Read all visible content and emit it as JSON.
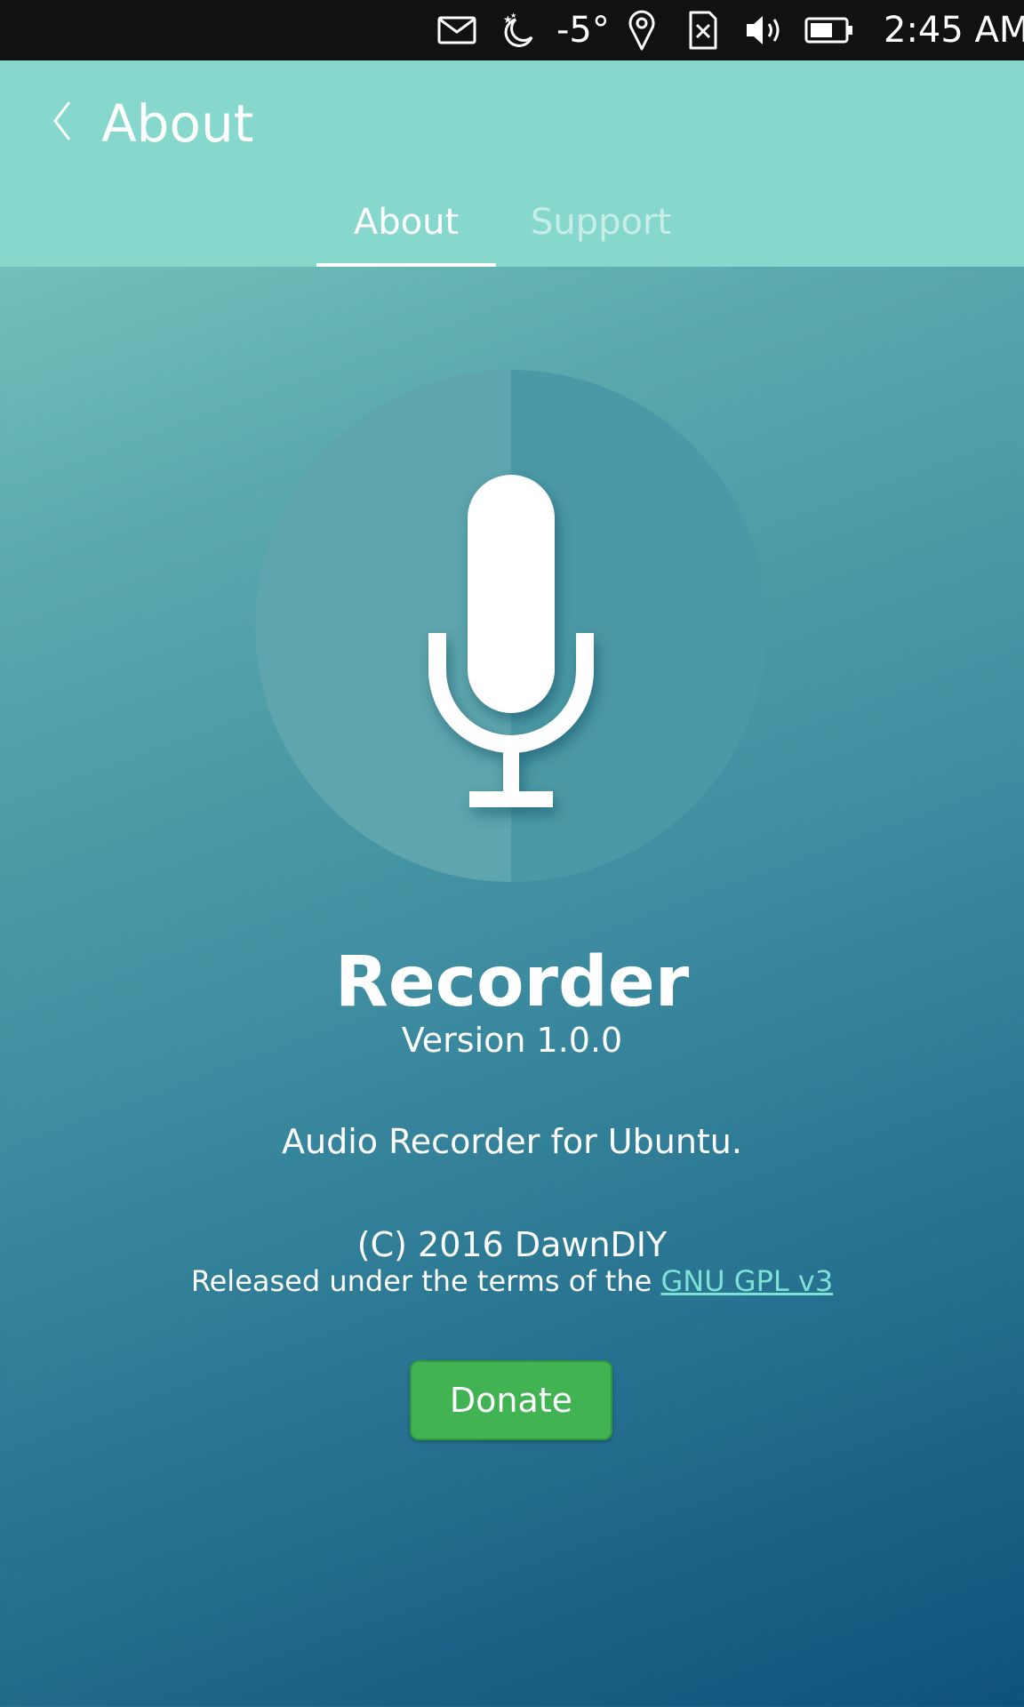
{
  "status_bar": {
    "icons": [
      "mail-icon",
      "night-mode-icon",
      "location-pin-icon",
      "no-sim-icon",
      "volume-icon",
      "battery-icon"
    ],
    "temperature": "-5°",
    "time": "2:45 AM"
  },
  "header": {
    "title": "About",
    "back_icon": "chevron-left-icon"
  },
  "tabs": [
    {
      "label": "About",
      "active": true
    },
    {
      "label": "Support",
      "active": false
    }
  ],
  "app": {
    "icon": "microphone-icon",
    "name": "Recorder",
    "version": "Version 1.0.0",
    "description": "Audio Recorder for Ubuntu.",
    "copyright": "(C) 2016 DawnDIY",
    "license_prefix": "Released under the terms of the",
    "license_link": "GNU GPL v3",
    "donate_label": "Donate"
  },
  "colors": {
    "status_bar": "#111111",
    "header": "#86d8cc",
    "gradient_top": "#86d4c8",
    "gradient_bottom": "#0e527a",
    "donate": "#41b353",
    "link": "#7fe0d6"
  }
}
